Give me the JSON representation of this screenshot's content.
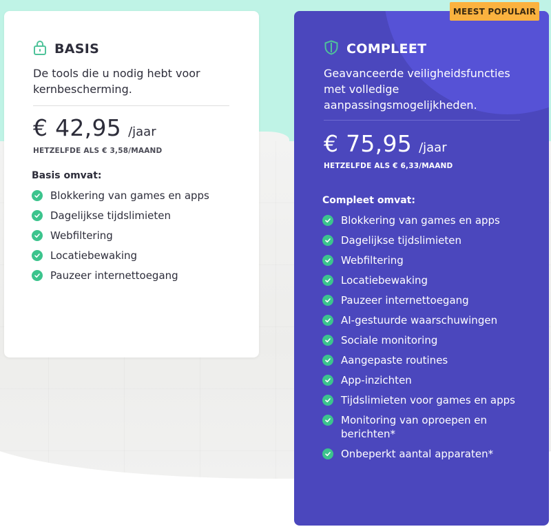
{
  "badge": "MEEST POPULAIR",
  "colors": {
    "accent_purple": "#4b47bd",
    "badge_orange": "#fbb23f",
    "check_green": "#3cc48d",
    "icon_green": "#4fc39a",
    "mint_background": "#bff3e6"
  },
  "plans": [
    {
      "icon": "lock-icon",
      "name": "BASIS",
      "description": "De tools die u nodig hebt voor kernbescherming.",
      "price": "€ 42,95",
      "period": "/jaar",
      "equivalent": "HETZELFDE ALS € 3,58/MAAND",
      "includes_label": "Basis omvat:",
      "features": [
        "Blokkering van games en apps",
        "Dagelijkse tijdslimieten",
        "Webfiltering",
        "Locatiebewaking",
        "Pauzeer internettoegang"
      ]
    },
    {
      "icon": "shield-icon",
      "name": "COMPLEET",
      "description": "Geavanceerde veiligheidsfuncties met volledige aanpassingsmogelijkheden.",
      "price": "€ 75,95",
      "period": "/jaar",
      "equivalent": "HETZELFDE ALS € 6,33/MAAND",
      "includes_label": "Compleet omvat:",
      "features": [
        "Blokkering van games en apps",
        "Dagelijkse tijdslimieten",
        "Webfiltering",
        "Locatiebewaking",
        "Pauzeer internettoegang",
        "AI-gestuurde waarschuwingen",
        "Sociale monitoring",
        "Aangepaste routines",
        "App-inzichten",
        "Tijdslimieten voor games en apps",
        "Monitoring van oproepen en berichten*",
        "Onbeperkt aantal apparaten*"
      ]
    }
  ]
}
